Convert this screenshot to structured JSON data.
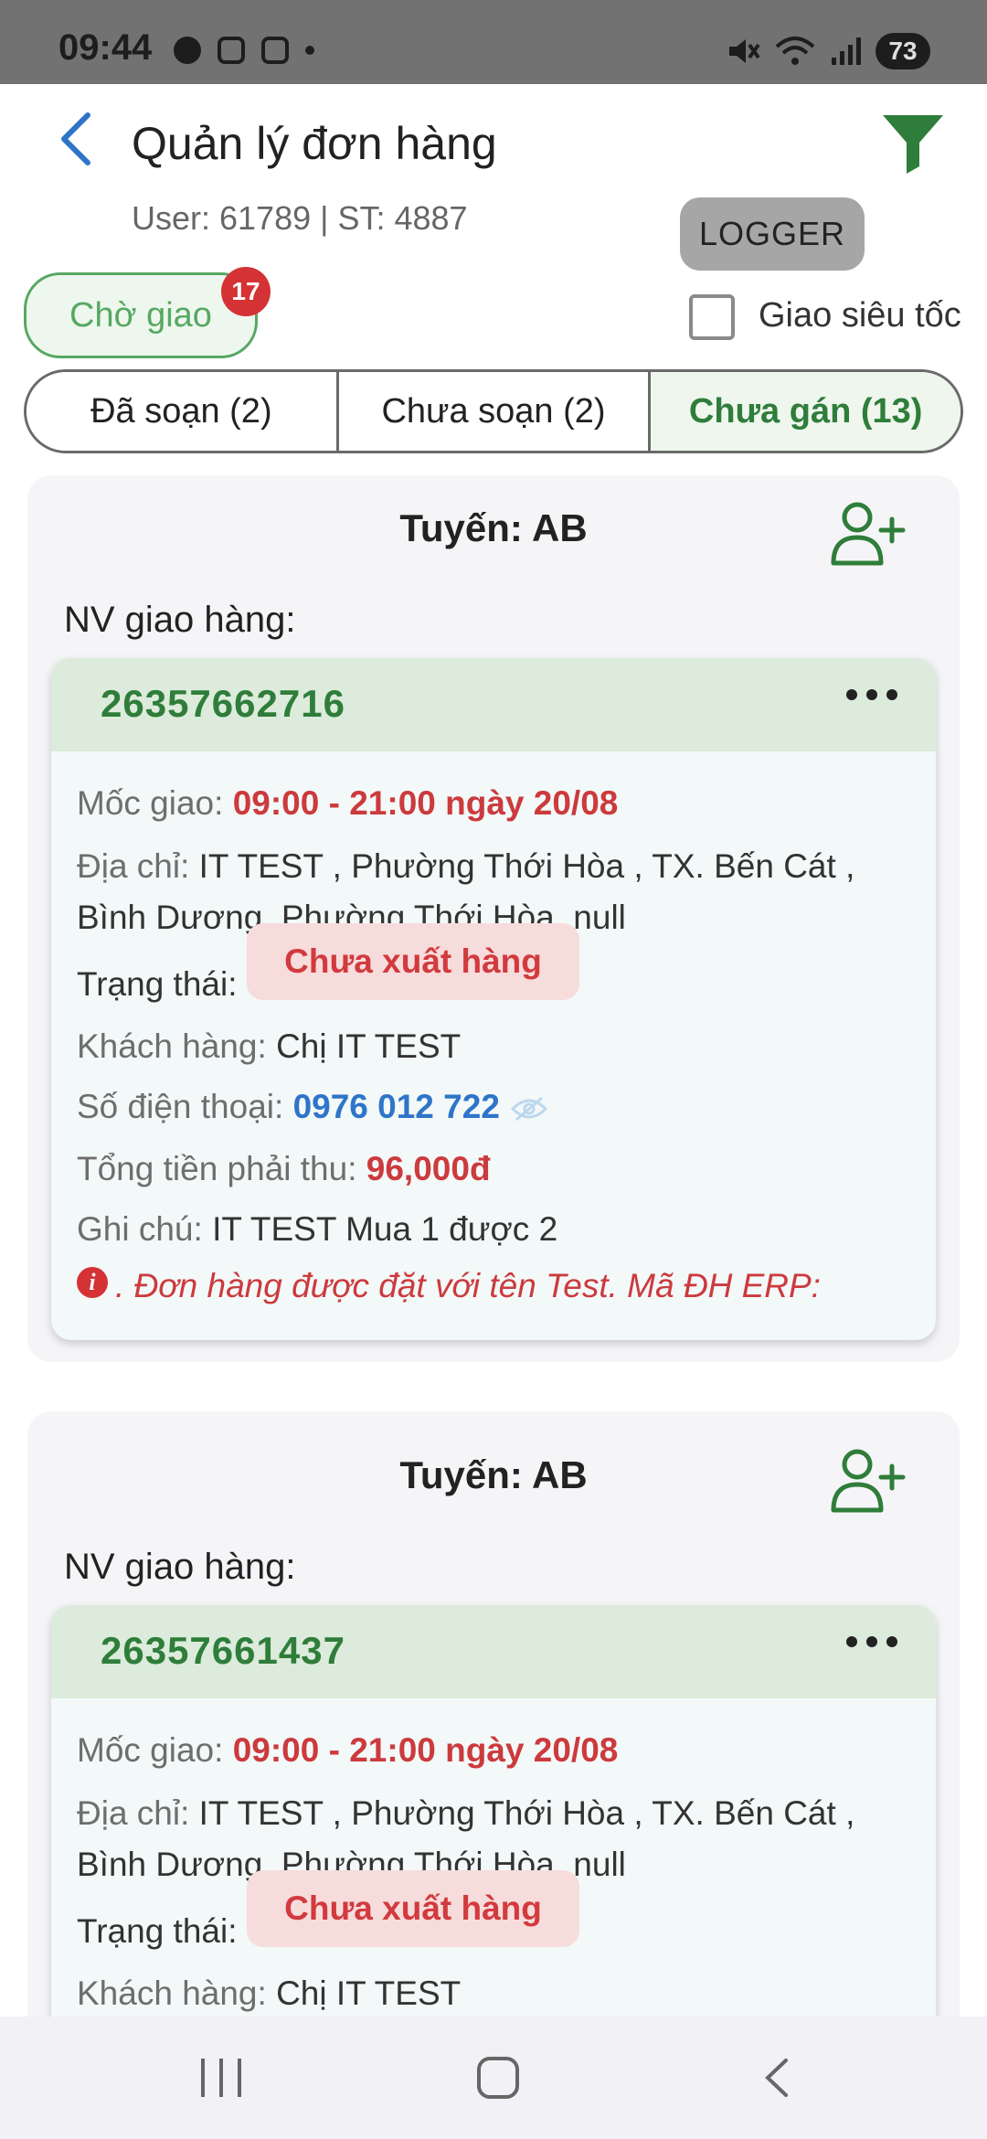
{
  "status_bar": {
    "time": "09:44",
    "battery": "73"
  },
  "header": {
    "title": "Quản lý đơn hàng",
    "user_line": "User: 61789 | ST: 4887",
    "logger_label": "LOGGER"
  },
  "filters": {
    "wait_chip_label": "Chờ giao",
    "wait_badge": "17",
    "fast_delivery_label": "Giao siêu tốc",
    "fast_delivery_checked": false
  },
  "tabs": [
    {
      "label": "Đã soạn (2)",
      "active": false
    },
    {
      "label": "Chưa soạn (2)",
      "active": false
    },
    {
      "label": "Chưa gán (13)",
      "active": true
    }
  ],
  "groups": [
    {
      "route": "Tuyến: AB",
      "nv_label": "NV giao hàng:",
      "order": {
        "id": "26357662716",
        "moc_label": "Mốc giao: ",
        "moc_value": "09:00 - 21:00 ngày 20/08",
        "address_label": "Địa chỉ: ",
        "address_value": "IT TEST , Phường Thới Hòa , TX. Bến Cát , Bình Dương, Phường Thới Hòa, null",
        "status_label": "Trạng thái:",
        "status_value": "Chưa xuất hàng",
        "customer_label": "Khách hàng: ",
        "customer_value": "Chị IT TEST",
        "phone_label": "Số điện thoại: ",
        "phone_value": "0976 012 722",
        "total_label": "Tổng tiền phải thu: ",
        "total_value": "96,000đ",
        "note_label": "Ghi chú: ",
        "note_value": "IT TEST Mua 1 được 2",
        "warning": ". Đơn hàng được đặt với tên Test. Mã ĐH ERP:"
      }
    },
    {
      "route": "Tuyến: AB",
      "nv_label": "NV giao hàng:",
      "order": {
        "id": "26357661437",
        "moc_label": "Mốc giao: ",
        "moc_value": "09:00 - 21:00 ngày 20/08",
        "address_label": "Địa chỉ: ",
        "address_value": "IT TEST , Phường Thới Hòa , TX. Bến Cát , Bình Dương, Phường Thới Hòa, null",
        "status_label": "Trạng thái:",
        "status_value": "Chưa xuất hàng",
        "customer_label": "Khách hàng: ",
        "customer_value": "Chị IT TEST"
      }
    }
  ],
  "colors": {
    "accent_green": "#2f7d3a",
    "chip_green": "#57a862",
    "badge_red": "#d43235",
    "value_red": "#cc3a3d",
    "phone_blue": "#2e75c9",
    "back_blue": "#2e75c9"
  },
  "icons": {
    "back": "chevron-left-icon",
    "filter": "funnel-icon",
    "assign": "person-add-icon",
    "more": "more-horizontal-icon",
    "eye": "eye-off-icon",
    "info": "info-icon"
  }
}
